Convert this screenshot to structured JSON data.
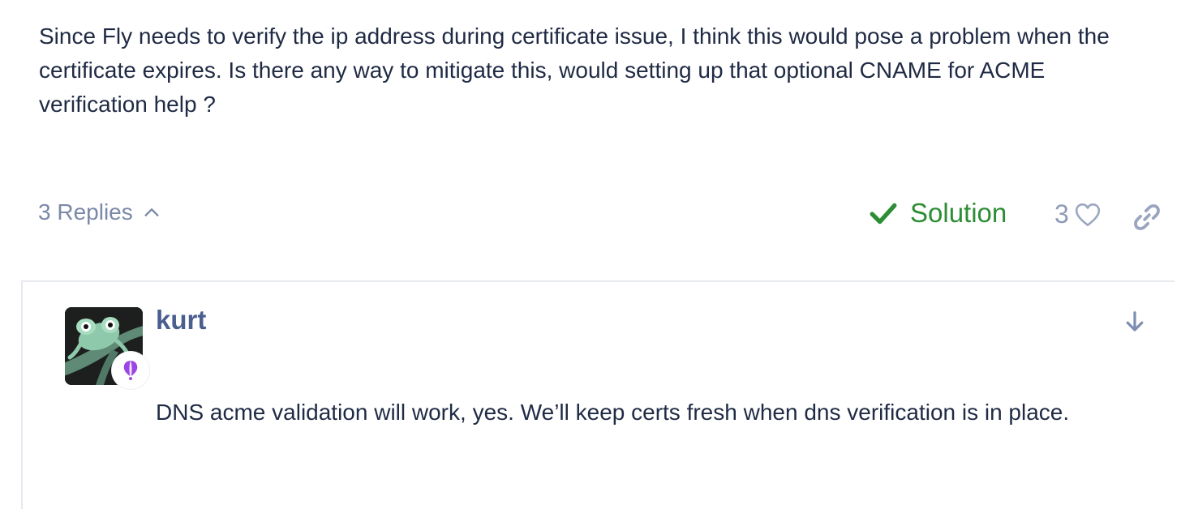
{
  "post": {
    "body": "Since Fly needs to verify the ip address during certificate issue, I think this would pose a problem when the certificate expires. Is there any way to mitigate this, would setting up that optional CNAME for ACME verification help ?"
  },
  "controls": {
    "replies_label": "3 Replies",
    "solution_label": "Solution",
    "like_count": "3"
  },
  "reply": {
    "username": "kurt",
    "body": "DNS acme validation will work, yes. We’ll keep certs fresh when dns verification is in place."
  },
  "colors": {
    "text": "#1f2a44",
    "muted": "#7b89a8",
    "solution": "#2c8d34",
    "username": "#4a5f8f",
    "badge": "#9b45e4"
  },
  "icons": {
    "replies_toggle": "chevron-up-icon",
    "solution": "check-icon",
    "like": "heart-icon",
    "share": "link-icon",
    "jump": "arrow-down-icon",
    "badge": "balloon-icon"
  }
}
